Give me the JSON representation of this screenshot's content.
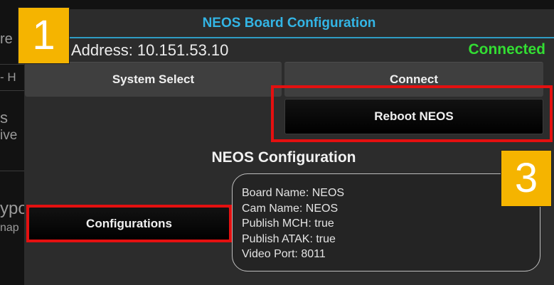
{
  "dialog": {
    "title": "NEOS Board Configuration",
    "address": "Address: 10.151.53.10",
    "connection_status": "Connected",
    "buttons": {
      "system_select": "System Select",
      "connect": "Connect",
      "reboot": "Reboot NEOS",
      "configurations": "Configurations"
    },
    "section_title": "NEOS Configuration",
    "info_lines": [
      "Board Name: NEOS",
      "Cam Name: NEOS",
      "Publish MCH: true",
      "Publish ATAK: true",
      "Video Port: 8011"
    ]
  },
  "background_fragments": [
    "re",
    "- H",
    "s",
    "ive",
    "ypo",
    "nap"
  ],
  "callouts": [
    "1",
    "3"
  ],
  "colors": {
    "title": "#33b5e5",
    "title_underline": "#2f9cc4",
    "connected": "#33dd33",
    "highlight": "#e41010",
    "badge": "#f5b400"
  }
}
